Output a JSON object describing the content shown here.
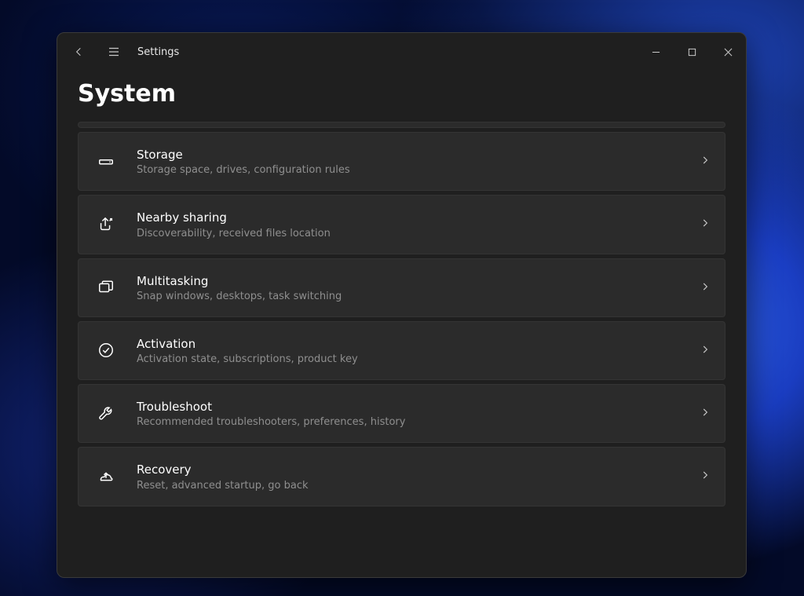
{
  "app": {
    "title": "Settings"
  },
  "page": {
    "heading": "System"
  },
  "items": [
    {
      "icon": "storage-icon",
      "title": "Storage",
      "desc": "Storage space, drives, configuration rules"
    },
    {
      "icon": "share-icon",
      "title": "Nearby sharing",
      "desc": "Discoverability, received files location"
    },
    {
      "icon": "multitask-icon",
      "title": "Multitasking",
      "desc": "Snap windows, desktops, task switching"
    },
    {
      "icon": "activation-icon",
      "title": "Activation",
      "desc": "Activation state, subscriptions, product key"
    },
    {
      "icon": "troubleshoot-icon",
      "title": "Troubleshoot",
      "desc": "Recommended troubleshooters, preferences, history"
    },
    {
      "icon": "recovery-icon",
      "title": "Recovery",
      "desc": "Reset, advanced startup, go back"
    }
  ]
}
